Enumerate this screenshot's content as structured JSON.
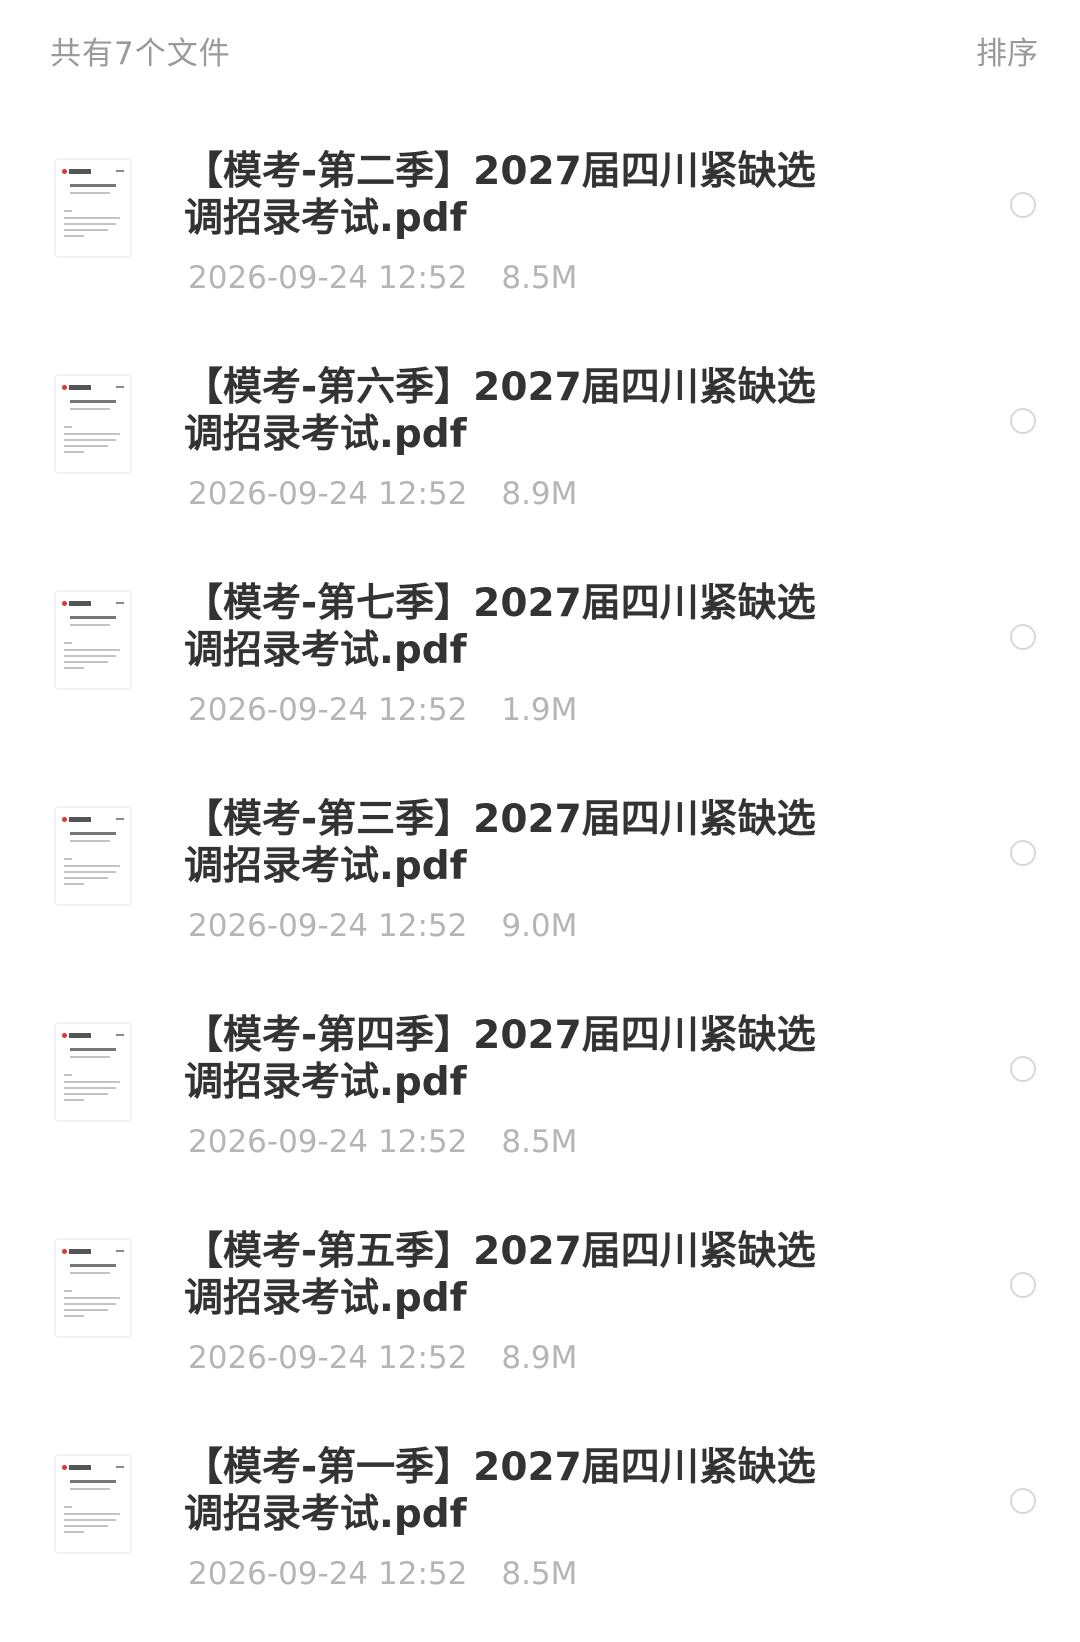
{
  "header": {
    "file_count": "共有7个文件",
    "sort_label": "排序"
  },
  "files": [
    {
      "name": "【模考-第二季】2027届四川紧缺选调招录考试.pdf",
      "date": "2026-09-24 12:52",
      "size": "8.5M",
      "icon": "pdf-thumbnail-icon"
    },
    {
      "name": "【模考-第六季】2027届四川紧缺选调招录考试.pdf",
      "date": "2026-09-24 12:52",
      "size": "8.9M",
      "icon": "pdf-thumbnail-icon"
    },
    {
      "name": "【模考-第七季】2027届四川紧缺选调招录考试.pdf",
      "date": "2026-09-24 12:52",
      "size": "1.9M",
      "icon": "pdf-thumbnail-icon"
    },
    {
      "name": "【模考-第三季】2027届四川紧缺选调招录考试.pdf",
      "date": "2026-09-24 12:52",
      "size": "9.0M",
      "icon": "pdf-thumbnail-icon"
    },
    {
      "name": "【模考-第四季】2027届四川紧缺选调招录考试.pdf",
      "date": "2026-09-24 12:52",
      "size": "8.5M",
      "icon": "pdf-thumbnail-icon"
    },
    {
      "name": "【模考-第五季】2027届四川紧缺选调招录考试.pdf",
      "date": "2026-09-24 12:52",
      "size": "8.9M",
      "icon": "pdf-thumbnail-icon"
    },
    {
      "name": "【模考-第一季】2027届四川紧缺选调招录考试.pdf",
      "date": "2026-09-24 12:52",
      "size": "8.5M",
      "icon": "pdf-thumbnail-icon"
    }
  ],
  "colors": {
    "title_text": "#333333",
    "meta_text": "#b5b5b5",
    "header_text": "#9a9a9a",
    "radio_border": "#d8d8d8"
  }
}
